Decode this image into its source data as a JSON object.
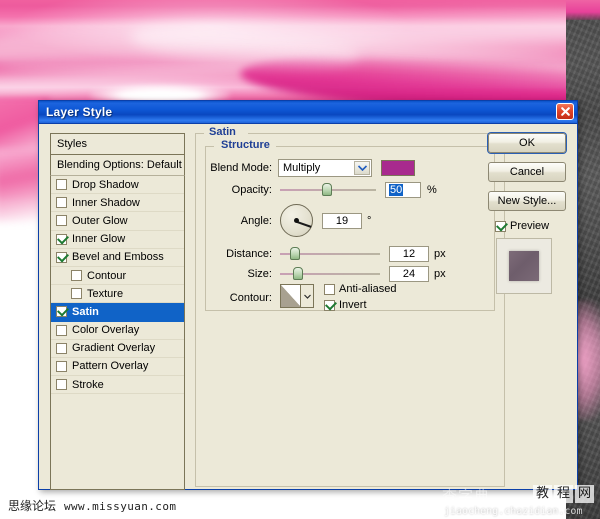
{
  "window": {
    "title": "Layer Style",
    "close_icon": "close-icon"
  },
  "sidebar": {
    "header": "Styles",
    "blending_options": "Blending Options: Default",
    "items": [
      {
        "label": "Drop Shadow",
        "checked": false,
        "indent": false,
        "selected": false
      },
      {
        "label": "Inner Shadow",
        "checked": false,
        "indent": false,
        "selected": false
      },
      {
        "label": "Outer Glow",
        "checked": false,
        "indent": false,
        "selected": false
      },
      {
        "label": "Inner Glow",
        "checked": true,
        "indent": false,
        "selected": false
      },
      {
        "label": "Bevel and Emboss",
        "checked": true,
        "indent": false,
        "selected": false
      },
      {
        "label": "Contour",
        "checked": false,
        "indent": true,
        "selected": false
      },
      {
        "label": "Texture",
        "checked": false,
        "indent": true,
        "selected": false
      },
      {
        "label": "Satin",
        "checked": true,
        "indent": false,
        "selected": true
      },
      {
        "label": "Color Overlay",
        "checked": false,
        "indent": false,
        "selected": false
      },
      {
        "label": "Gradient Overlay",
        "checked": false,
        "indent": false,
        "selected": false
      },
      {
        "label": "Pattern Overlay",
        "checked": false,
        "indent": false,
        "selected": false
      },
      {
        "label": "Stroke",
        "checked": false,
        "indent": false,
        "selected": false
      }
    ]
  },
  "main": {
    "group_title": "Satin",
    "structure_title": "Structure",
    "blend_mode": {
      "label": "Blend Mode:",
      "value": "Multiply",
      "color_swatch": "#a82a8e"
    },
    "opacity": {
      "label": "Opacity:",
      "value": "50",
      "unit": "%",
      "slider_pct": 50
    },
    "angle": {
      "label": "Angle:",
      "value": "19",
      "unit": "°"
    },
    "distance": {
      "label": "Distance:",
      "value": "12",
      "unit": "px",
      "slider_pct": 13
    },
    "size": {
      "label": "Size:",
      "value": "24",
      "unit": "px",
      "slider_pct": 16
    },
    "contour": {
      "label": "Contour:",
      "anti_aliased": {
        "label": "Anti-aliased",
        "checked": false
      },
      "invert": {
        "label": "Invert",
        "checked": true
      }
    }
  },
  "buttons": {
    "ok": "OK",
    "cancel": "Cancel",
    "new_style": "New Style...",
    "preview": {
      "label": "Preview",
      "checked": true
    }
  },
  "watermarks": {
    "left_name": "思缘论坛",
    "left_url": "www.missyuan.com",
    "right_ghost": "查字典",
    "right_boxes": [
      "教",
      "程",
      "网"
    ],
    "right_url": "jiaocheng.chazidian.com"
  },
  "colors": {
    "titlebar_blue": "#0e57d6",
    "selection_blue": "#1063c7",
    "dialog_face": "#ece9d8",
    "group_label_blue": "#1f3f95",
    "swatch_magenta": "#a82a8e"
  }
}
